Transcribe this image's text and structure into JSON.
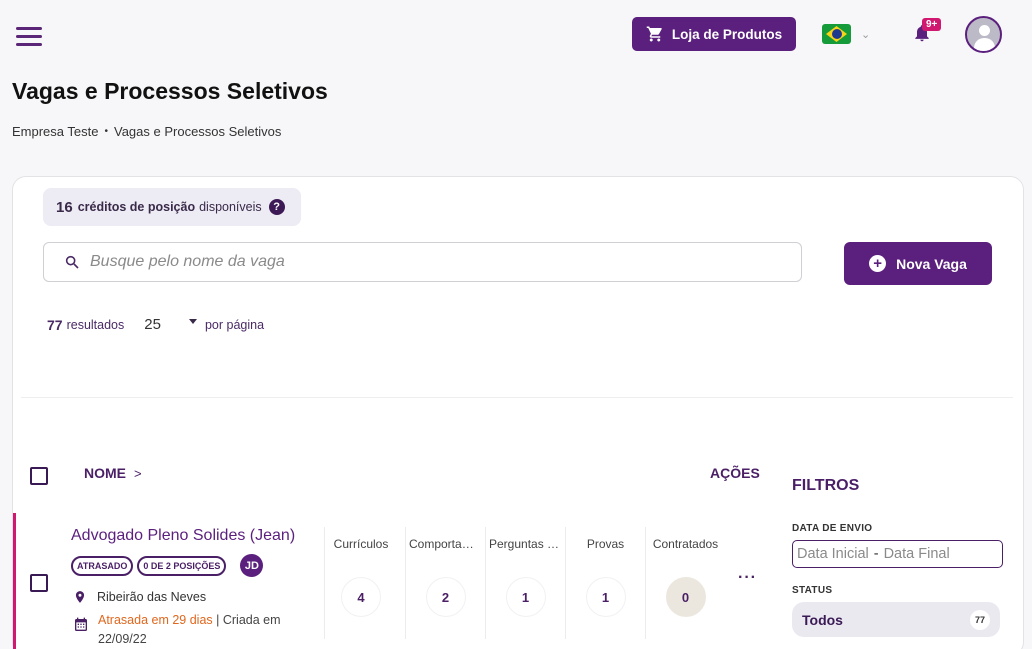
{
  "header": {
    "shop_label": "Loja de Produtos",
    "notifications_badge": "9+"
  },
  "page": {
    "title": "Vagas e Processos Seletivos",
    "breadcrumb": [
      "Empresa Teste",
      "Vagas e Processos Seletivos"
    ]
  },
  "credits": {
    "count": "16",
    "bold_label": "créditos de posição",
    "suffix": "disponíveis"
  },
  "search": {
    "placeholder": "Busque pelo nome da vaga"
  },
  "new_job_label": "Nova Vaga",
  "results": {
    "count": "77",
    "label": "resultados",
    "per_page_value": "25",
    "per_page_label": "por página"
  },
  "table": {
    "col_name": "NOME",
    "col_actions": "AÇÕES",
    "rows": [
      {
        "title": "Advogado Pleno Solides (Jean)",
        "tags": [
          "ATRASADO",
          "0 DE 2 POSIÇÕES"
        ],
        "owner_initials": "JD",
        "location": "Ribeirão das Neves",
        "late_text": "Atrasada em 29 dias",
        "created_text": "|  Criada em 22/09/22",
        "stages": [
          {
            "label": "Currículos",
            "count": "4"
          },
          {
            "label": "Comportamental",
            "count": "2"
          },
          {
            "label": "Perguntas de seleção",
            "count": "1"
          },
          {
            "label": "Provas",
            "count": "1"
          },
          {
            "label": "Contratados",
            "count": "0"
          }
        ],
        "more": "···"
      }
    ]
  },
  "filters": {
    "title": "FILTROS",
    "date_label": "DATA DE ENVIO",
    "date_start_placeholder": "Data Inicial",
    "date_end_placeholder": "Data Final",
    "status_label": "STATUS",
    "status_option": {
      "label": "Todos",
      "count": "77"
    }
  }
}
